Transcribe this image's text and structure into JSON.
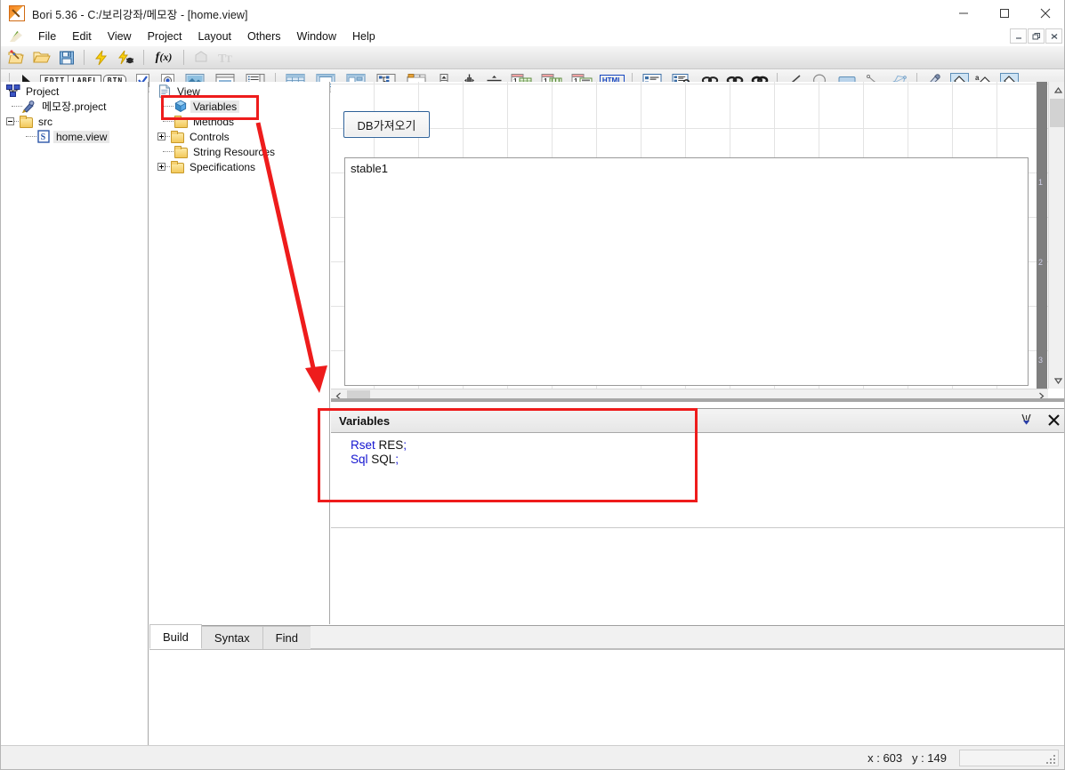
{
  "window": {
    "title": "Bori 5.36 - C:/보리강좌/메모장 - [home.view]",
    "app_icon": "quill-icon",
    "controls": [
      {
        "name": "minimize-button",
        "glyph": "minimize-icon"
      },
      {
        "name": "maximize-button",
        "glyph": "maximize-icon"
      },
      {
        "name": "close-button",
        "glyph": "close-icon"
      }
    ],
    "mdi_controls": [
      {
        "name": "mdi-minimize-button",
        "glyph": "minimize-icon",
        "char": "_"
      },
      {
        "name": "mdi-restore-button",
        "glyph": "restore-icon",
        "char": "❐"
      },
      {
        "name": "mdi-close-button",
        "glyph": "close-icon",
        "char": "✕"
      }
    ]
  },
  "menubar": {
    "icon": "bori-menu-icon",
    "items": [
      {
        "label": "File"
      },
      {
        "label": "Edit"
      },
      {
        "label": "View"
      },
      {
        "label": "Project"
      },
      {
        "label": "Layout"
      },
      {
        "label": "Others"
      },
      {
        "label": "Window"
      },
      {
        "label": "Help"
      }
    ]
  },
  "toolbar1": {
    "items": [
      {
        "name": "new-project-icon",
        "type": "icon"
      },
      {
        "name": "open-folder-icon",
        "type": "icon"
      },
      {
        "name": "save-icon",
        "type": "icon"
      },
      {
        "name": "separator",
        "type": "sep"
      },
      {
        "name": "build-icon",
        "type": "icon"
      },
      {
        "name": "debug-icon",
        "type": "icon"
      },
      {
        "name": "separator",
        "type": "sep"
      },
      {
        "name": "function-icon",
        "type": "icon"
      },
      {
        "name": "separator",
        "type": "sep"
      },
      {
        "name": "shape-icon-disabled",
        "type": "icon"
      },
      {
        "name": "text-tool-icon-disabled",
        "type": "icon"
      }
    ]
  },
  "toolbar2": {
    "items": [
      {
        "name": "separator",
        "type": "sep"
      },
      {
        "name": "pointer-icon",
        "type": "icon"
      },
      {
        "name": "edit-control-icon",
        "type": "tag",
        "text": "EDIT"
      },
      {
        "name": "label-control-icon",
        "type": "tag",
        "text": "LABEL"
      },
      {
        "name": "button-control-icon",
        "type": "tag",
        "text": "BTN"
      },
      {
        "name": "checkbox-control-icon",
        "type": "icon"
      },
      {
        "name": "radio-control-icon",
        "type": "icon"
      },
      {
        "name": "image-control-icon",
        "type": "icon"
      },
      {
        "name": "groupbox-control-icon",
        "type": "icon"
      },
      {
        "name": "listbox-control-icon",
        "type": "icon"
      },
      {
        "name": "separator",
        "type": "sep"
      },
      {
        "name": "grid-control-icon",
        "type": "icon"
      },
      {
        "name": "form-control-icon",
        "type": "icon"
      },
      {
        "name": "split-control-icon",
        "type": "icon"
      },
      {
        "name": "tree-control-icon",
        "type": "icon"
      },
      {
        "name": "tab-control-icon",
        "type": "icon"
      },
      {
        "name": "spin-control-icon",
        "type": "icon"
      },
      {
        "name": "vsplitter-icon",
        "type": "icon"
      },
      {
        "name": "hsplitter-icon",
        "type": "icon"
      },
      {
        "name": "dataset-grid-icon",
        "type": "icon"
      },
      {
        "name": "dataset-column-icon",
        "type": "icon"
      },
      {
        "name": "dataset-list-icon",
        "type": "icon"
      },
      {
        "name": "html-control-icon",
        "type": "tag",
        "text": "HTML"
      },
      {
        "name": "separator",
        "type": "sep"
      },
      {
        "name": "detail-list-icon",
        "type": "icon"
      },
      {
        "name": "property-list-icon",
        "type": "icon"
      },
      {
        "name": "link-icon-1",
        "type": "icon"
      },
      {
        "name": "link-icon-2",
        "type": "icon"
      },
      {
        "name": "link-icon-3",
        "type": "icon"
      },
      {
        "name": "separator",
        "type": "sep"
      },
      {
        "name": "line-tool-icon",
        "type": "icon"
      },
      {
        "name": "ellipse-tool-icon",
        "type": "icon"
      },
      {
        "name": "rectangle-tool-icon",
        "type": "icon"
      },
      {
        "name": "polyline-tool-icon",
        "type": "icon"
      },
      {
        "name": "polygon-tool-icon",
        "type": "icon"
      },
      {
        "name": "separator",
        "type": "sep"
      },
      {
        "name": "eyedropper-icon",
        "type": "icon"
      },
      {
        "name": "fill-color-icon",
        "type": "icon"
      },
      {
        "name": "text-color-icon",
        "type": "icon"
      },
      {
        "name": "border-color-icon",
        "type": "icon"
      }
    ]
  },
  "project_tree": {
    "root": {
      "label": "Project",
      "icon": "project-node-icon"
    },
    "items": [
      {
        "label": "메모장.project",
        "icon": "project-file-icon",
        "indent": 1,
        "expander": "none",
        "selected": false
      },
      {
        "label": "src",
        "icon": "folder-icon",
        "indent": 1,
        "expander": "minus",
        "selected": false
      },
      {
        "label": "home.view",
        "icon": "view-file-icon",
        "indent": 2,
        "expander": "none",
        "selected": true
      }
    ]
  },
  "view_tree": {
    "items": [
      {
        "label": "View",
        "icon": "view-doc-icon",
        "indent": 0,
        "expander": "minus",
        "selected": false
      },
      {
        "label": "Variables",
        "icon": "variables-icon",
        "indent": 1,
        "expander": "none",
        "selected": true
      },
      {
        "label": "Methods",
        "icon": "folder-icon",
        "indent": 1,
        "expander": "none",
        "selected": false
      },
      {
        "label": "Controls",
        "icon": "folder-icon",
        "indent": 1,
        "expander": "plus",
        "selected": false
      },
      {
        "label": "String Resources",
        "icon": "folder-icon",
        "indent": 1,
        "expander": "none",
        "selected": false
      },
      {
        "label": "Specifications",
        "icon": "folder-icon",
        "indent": 1,
        "expander": "plus",
        "selected": false
      }
    ]
  },
  "canvas": {
    "db_button_label": "DB가져오기",
    "stable_label": "stable1",
    "ruler_marks": [
      "1",
      "2",
      "3"
    ],
    "scroll": {
      "up_arrow": "▲",
      "down_arrow": "▼",
      "left_arrow": "‹",
      "right_arrow": "›"
    }
  },
  "variables_panel": {
    "title": "Variables",
    "header_buttons": [
      {
        "name": "auto-hide-pin-icon"
      },
      {
        "name": "close-panel-button",
        "char": "✕"
      }
    ],
    "code_lines": [
      {
        "type": "Rset",
        "name": " RES",
        "semi": ";"
      },
      {
        "type": "Sql",
        "name": " SQL",
        "semi": ";"
      }
    ]
  },
  "output_panel": {
    "tabs": [
      {
        "label": "Build",
        "active": true
      },
      {
        "label": "Syntax",
        "active": false
      },
      {
        "label": "Find",
        "active": false
      }
    ]
  },
  "statusbar": {
    "coordinates": "x : 603   y : 149"
  },
  "annotations": {
    "accent_color": "#ee1c1c",
    "highlight_variables_tree": true,
    "highlight_variables_panel": true,
    "arrow": "points from Variables tree node down to Variables panel"
  },
  "colors": {
    "accent_red": "#ee1c1c",
    "keyword_blue": "#1414d0",
    "button_border_blue": "#2c5f96",
    "grid_line": "#e3e3e3",
    "ruler_gray": "#7e7e7e"
  }
}
